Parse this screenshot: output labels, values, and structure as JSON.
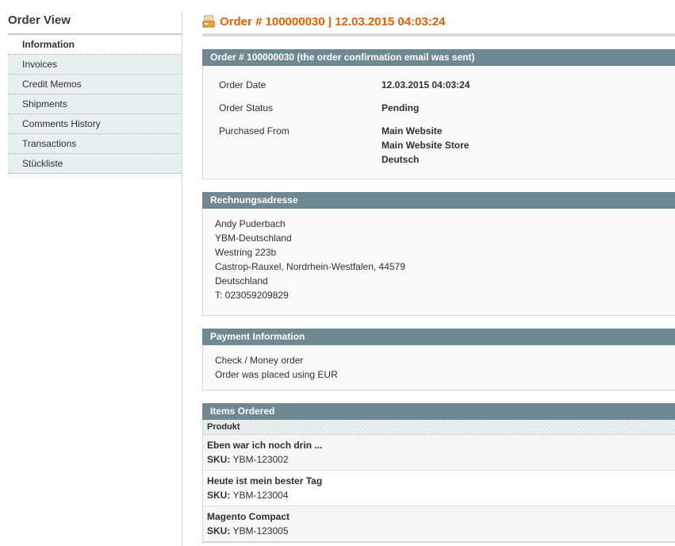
{
  "sidebar": {
    "title": "Order View",
    "tabs": [
      {
        "label": "Information"
      },
      {
        "label": "Invoices"
      },
      {
        "label": "Credit Memos"
      },
      {
        "label": "Shipments"
      },
      {
        "label": "Comments History"
      },
      {
        "label": "Transactions"
      },
      {
        "label": "Stückliste"
      }
    ]
  },
  "header": {
    "title": "Order # 100000030 | 12.03.2015 04:03:24",
    "icon": "order-document-icon",
    "accent": "#eb5e00"
  },
  "order_box": {
    "title": "Order # 100000030 (the order confirmation email was sent)",
    "order_date_label": "Order Date",
    "order_date_value": "12.03.2015 04:03:24",
    "status_label": "Order Status",
    "status_value": "Pending",
    "purchased_from_label": "Purchased From",
    "purchased_from_lines": [
      "Main Website",
      "Main Website Store",
      "Deutsch"
    ]
  },
  "billing": {
    "title": "Rechnungsadresse",
    "lines": [
      "Andy Puderbach",
      "YBM-Deutschland",
      "Westring 223b",
      "Castrop-Rauxel, Nordrhein-Westfalen, 44579",
      "Deutschland",
      "T: 023059209829"
    ]
  },
  "payment": {
    "title": "Payment Information",
    "method": "Check / Money order",
    "currency_note": "Order was placed using EUR"
  },
  "items": {
    "title": "Items Ordered",
    "column_header": "Produkt",
    "sku_label": "SKU:",
    "rows": [
      {
        "name": "Eben war ich noch drin ...",
        "sku": "YBM-123002"
      },
      {
        "name": "Heute ist mein bester Tag",
        "sku": "YBM-123004"
      },
      {
        "name": "Magento Compact",
        "sku": "YBM-123005"
      }
    ]
  },
  "colors": {
    "box_header": "#6f8992",
    "tab_background": "#e7efef",
    "title_orange": "#eb5e00"
  }
}
